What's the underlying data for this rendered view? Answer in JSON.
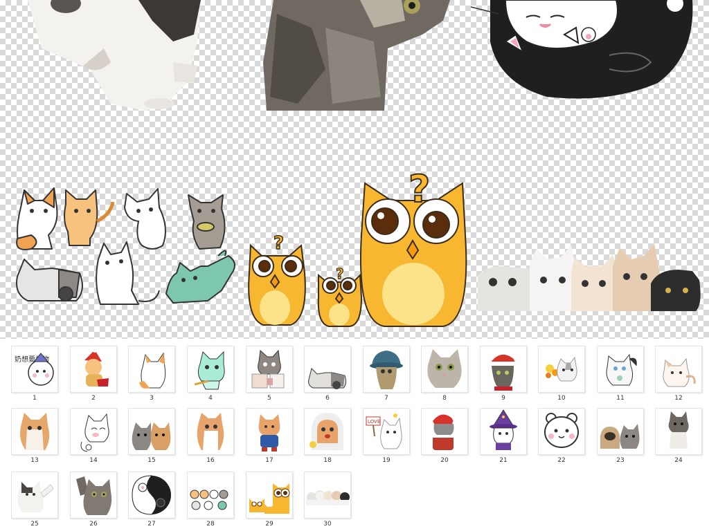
{
  "preview": {
    "owl_glyph": "?"
  },
  "thumbnails": [
    {
      "label": "1",
      "icon": "bear-text-icon",
      "text": "奶想要礼物"
    },
    {
      "label": "2",
      "icon": "santa-cat-icon"
    },
    {
      "label": "3",
      "icon": "orange-cat-icon"
    },
    {
      "label": "4",
      "icon": "mint-cat-icon"
    },
    {
      "label": "5",
      "icon": "gray-cat-gift-icon"
    },
    {
      "label": "6",
      "icon": "lying-cat-icon"
    },
    {
      "label": "7",
      "icon": "kitten-hat-icon"
    },
    {
      "label": "8",
      "icon": "tabby-kitten-icon"
    },
    {
      "label": "9",
      "icon": "christmas-kitten-icon"
    },
    {
      "label": "10",
      "icon": "flower-cat-icon"
    },
    {
      "label": "11",
      "icon": "white-cat-icon"
    },
    {
      "label": "12",
      "icon": "cream-cat-icon"
    },
    {
      "label": "13",
      "icon": "ginger-kitten-icon"
    },
    {
      "label": "14",
      "icon": "cat-sketch-icon"
    },
    {
      "label": "15",
      "icon": "two-kittens-icon"
    },
    {
      "label": "16",
      "icon": "orange-kitten-icon"
    },
    {
      "label": "17",
      "icon": "costume-cat-icon"
    },
    {
      "label": "18",
      "icon": "kitten-hood-icon"
    },
    {
      "label": "19",
      "icon": "love-sign-cat-icon",
      "text": "LOVE"
    },
    {
      "label": "20",
      "icon": "santa-costume-icon"
    },
    {
      "label": "21",
      "icon": "wizard-cat-icon"
    },
    {
      "label": "22",
      "icon": "white-bear-icon"
    },
    {
      "label": "23",
      "icon": "pug-kitten-icon"
    },
    {
      "label": "24",
      "icon": "standing-kitten-icon"
    },
    {
      "label": "25",
      "icon": "waving-cat-icon"
    },
    {
      "label": "26",
      "icon": "reaching-cat-icon"
    },
    {
      "label": "27",
      "icon": "yin-yang-cats-icon"
    },
    {
      "label": "28",
      "icon": "cat-stickers-icon"
    },
    {
      "label": "29",
      "icon": "owls-icon"
    },
    {
      "label": "30",
      "icon": "cat-row-icon"
    }
  ]
}
